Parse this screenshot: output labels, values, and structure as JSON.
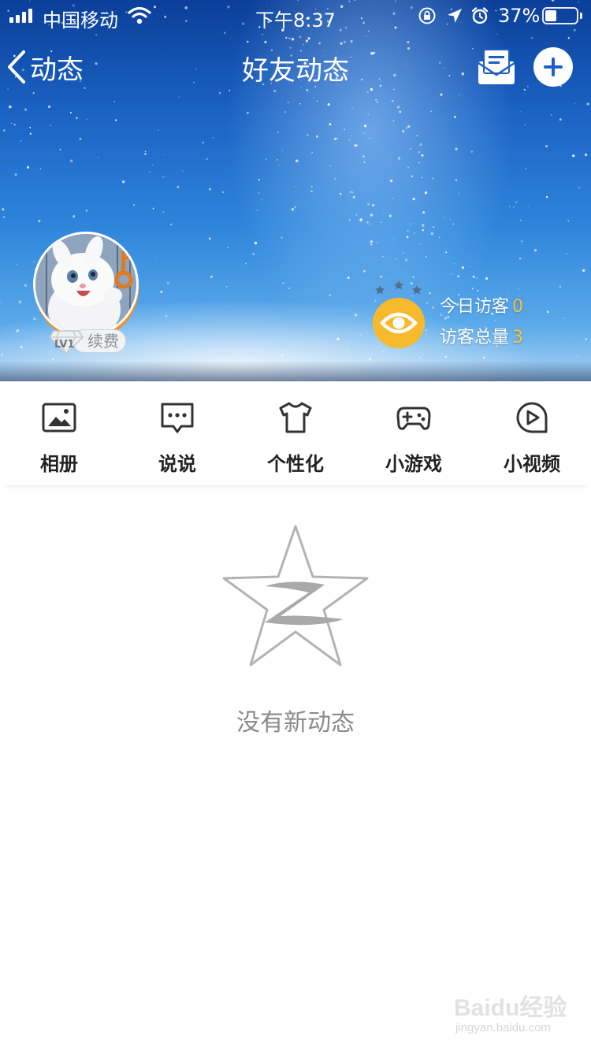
{
  "status_bar": {
    "carrier": "中国移动",
    "time": "下午8:37",
    "battery_text": "37%",
    "battery_level": 0.37
  },
  "nav": {
    "back_label": "动态",
    "title": "好友动态",
    "mail_icon": "mail-icon",
    "add_icon": "plus-circle-icon"
  },
  "profile": {
    "level": "LV1",
    "renew_label": "续费"
  },
  "visitors": {
    "today_label": "今日访客",
    "today_count": "0",
    "total_label": "访客总量",
    "total_count": "3",
    "eye_color": "#f7b92e",
    "count_color": "#f6c340"
  },
  "menu": {
    "items": [
      {
        "label": "相册",
        "icon": "photo-album-icon"
      },
      {
        "label": "说说",
        "icon": "chat-bubble-icon"
      },
      {
        "label": "个性化",
        "icon": "tshirt-icon"
      },
      {
        "label": "小游戏",
        "icon": "gamepad-icon"
      },
      {
        "label": "小视频",
        "icon": "play-circle-icon"
      }
    ]
  },
  "empty_state": {
    "message": "没有新动态",
    "icon": "qzone-star-icon"
  },
  "watermark": {
    "main": "Baidu经验",
    "sub": "jingyan.baidu.com"
  }
}
